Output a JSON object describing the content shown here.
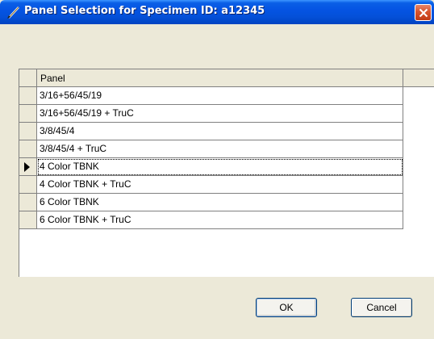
{
  "window": {
    "title": "Panel Selection for Specimen ID: a12345",
    "close_icon": "close-icon",
    "app_icon": "pen-icon"
  },
  "grid": {
    "header": {
      "panel": "Panel"
    },
    "current_row_index": 4,
    "row_indicator_icon": "current-row-arrow-icon",
    "rows": [
      {
        "panel": "3/16+56/45/19"
      },
      {
        "panel": "3/16+56/45/19 + TruC"
      },
      {
        "panel": "3/8/45/4"
      },
      {
        "panel": "3/8/45/4 + TruC"
      },
      {
        "panel": "4 Color TBNK"
      },
      {
        "panel": "4 Color TBNK + TruC"
      },
      {
        "panel": "6 Color TBNK"
      },
      {
        "panel": "6 Color TBNK + TruC"
      }
    ]
  },
  "buttons": {
    "ok_label": "OK",
    "cancel_label": "Cancel"
  },
  "colors": {
    "titlebar": "#0554e3",
    "close_button": "#d8542d",
    "dialog_background": "#ece9d8"
  }
}
